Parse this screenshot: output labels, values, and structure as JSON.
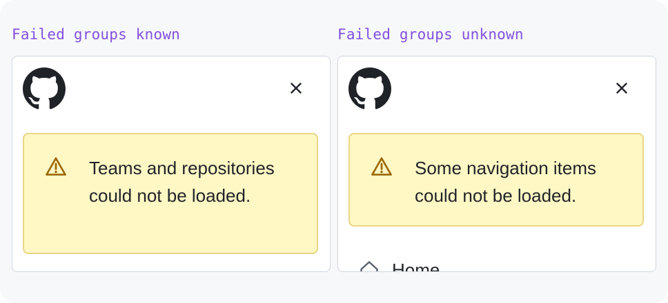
{
  "colors": {
    "background": "#f6f8fa",
    "title": "#8250df",
    "panel_border": "#d0d7de",
    "flash_bg": "#fff8c5",
    "flash_border": "#e9d686",
    "warning_icon": "#9a6700",
    "text": "#1f2328"
  },
  "variants": [
    {
      "title": "Failed groups known",
      "logo_icon": "github-mark-icon",
      "close_icon": "x-icon",
      "alert_icon": "alert-triangle-icon",
      "message": "Teams and repositories could not be loaded."
    },
    {
      "title": "Failed groups unknown",
      "logo_icon": "github-mark-icon",
      "close_icon": "x-icon",
      "alert_icon": "alert-triangle-icon",
      "message": "Some navigation items could not be loaded.",
      "nav_items": [
        {
          "icon": "home-icon",
          "label": "Home"
        }
      ]
    }
  ]
}
